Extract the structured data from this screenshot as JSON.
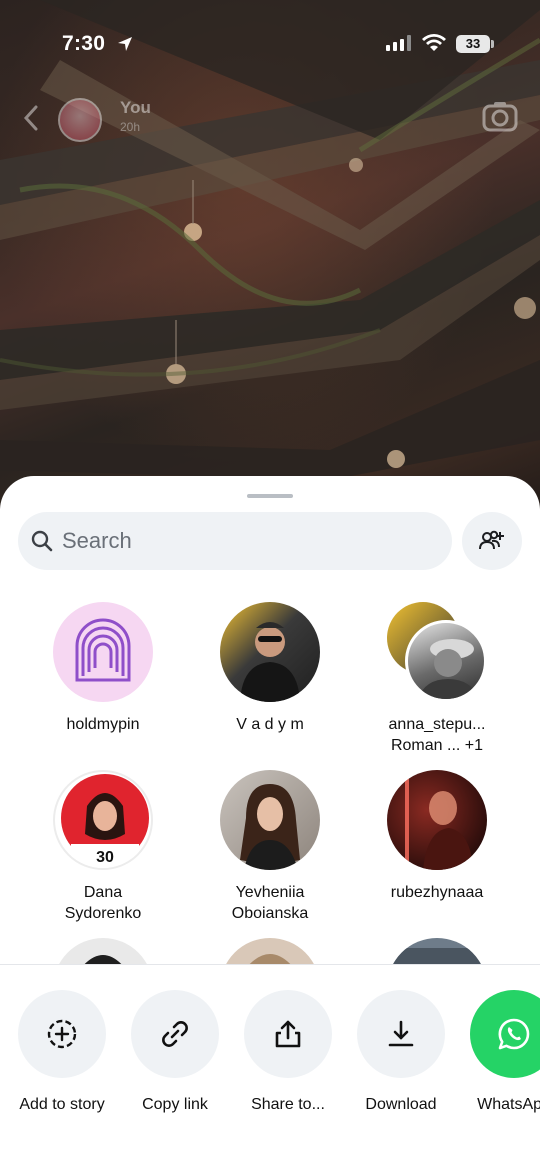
{
  "status_bar": {
    "time": "7:30",
    "battery": "33"
  },
  "story": {
    "user": "You",
    "time": "20h"
  },
  "search": {
    "placeholder": "Search"
  },
  "contacts": [
    {
      "name": "holdmypin"
    },
    {
      "name": "V a d y m"
    },
    {
      "name": "anna_stepu...",
      "name2": "Roman ... +1"
    },
    {
      "name": "Dana",
      "name2": "Sydorenko"
    },
    {
      "name": "Yevheniia",
      "name2": "Oboianska"
    },
    {
      "name": "rubezhynaaa"
    }
  ],
  "actions": [
    {
      "label": "Add to story",
      "icon": "add-story-icon"
    },
    {
      "label": "Copy link",
      "icon": "link-icon"
    },
    {
      "label": "Share to...",
      "icon": "share-icon"
    },
    {
      "label": "Download",
      "icon": "download-icon"
    },
    {
      "label": "WhatsApp",
      "icon": "whatsapp-icon"
    }
  ],
  "colors": {
    "whatsapp": "#25d366",
    "sheet_bg": "#ffffff",
    "chip_bg": "#eff2f5"
  }
}
